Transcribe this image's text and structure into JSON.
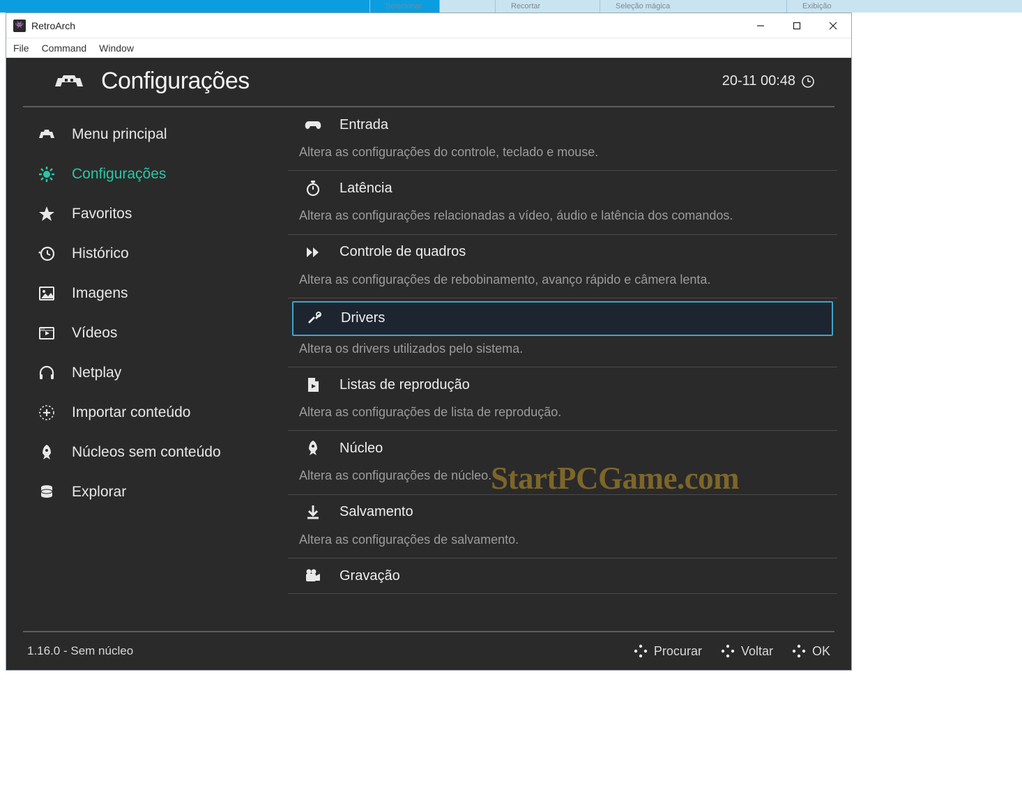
{
  "ghost_menu": [
    "Selecionar",
    "Recortar",
    "Seleção mágica",
    "Exibição"
  ],
  "window": {
    "title": "RetroArch",
    "menubar": [
      "File",
      "Command",
      "Window"
    ]
  },
  "header": {
    "page_title": "Configurações",
    "timestamp": "20-11 00:48"
  },
  "sidebar": {
    "items": [
      {
        "label": "Menu principal",
        "icon": "invader-icon",
        "active": false
      },
      {
        "label": "Configurações",
        "icon": "gear-icon",
        "active": true
      },
      {
        "label": "Favoritos",
        "icon": "star-icon",
        "active": false
      },
      {
        "label": "Histórico",
        "icon": "history-icon",
        "active": false
      },
      {
        "label": "Imagens",
        "icon": "image-icon",
        "active": false
      },
      {
        "label": "Vídeos",
        "icon": "video-icon",
        "active": false
      },
      {
        "label": "Netplay",
        "icon": "headset-icon",
        "active": false
      },
      {
        "label": "Importar conteúdo",
        "icon": "add-circle-icon",
        "active": false
      },
      {
        "label": "Núcleos sem conteúdo",
        "icon": "rocket-icon",
        "active": false
      },
      {
        "label": "Explorar",
        "icon": "database-icon",
        "active": false
      }
    ]
  },
  "settings": [
    {
      "icon": "gamepad-icon",
      "title": "Entrada",
      "desc": "Altera as configurações do controle, teclado e mouse.",
      "selected": false
    },
    {
      "icon": "stopwatch-icon",
      "title": "Latência",
      "desc": "Altera as configurações relacionadas a vídeo, áudio e latência dos comandos.",
      "selected": false
    },
    {
      "icon": "fastforward-icon",
      "title": "Controle de quadros",
      "desc": "Altera as configurações de rebobinamento, avanço rápido e câmera lenta.",
      "selected": false
    },
    {
      "icon": "tools-icon",
      "title": "Drivers",
      "desc": "Altera os drivers utilizados pelo sistema.",
      "selected": true
    },
    {
      "icon": "playlist-file-icon",
      "title": "Listas de reprodução",
      "desc": "Altera as configurações de lista de reprodução.",
      "selected": false
    },
    {
      "icon": "rocket-icon",
      "title": "Núcleo",
      "desc": "Altera as configurações de núcleo.",
      "selected": false
    },
    {
      "icon": "download-icon",
      "title": "Salvamento",
      "desc": "Altera as configurações de salvamento.",
      "selected": false
    },
    {
      "icon": "camera-icon",
      "title": "Gravação",
      "desc": "",
      "selected": false
    }
  ],
  "footer": {
    "version": "1.16.0 - Sem núcleo",
    "actions": [
      {
        "label": "Procurar"
      },
      {
        "label": "Voltar"
      },
      {
        "label": "OK"
      }
    ]
  },
  "watermark": "StartPCGame.com"
}
